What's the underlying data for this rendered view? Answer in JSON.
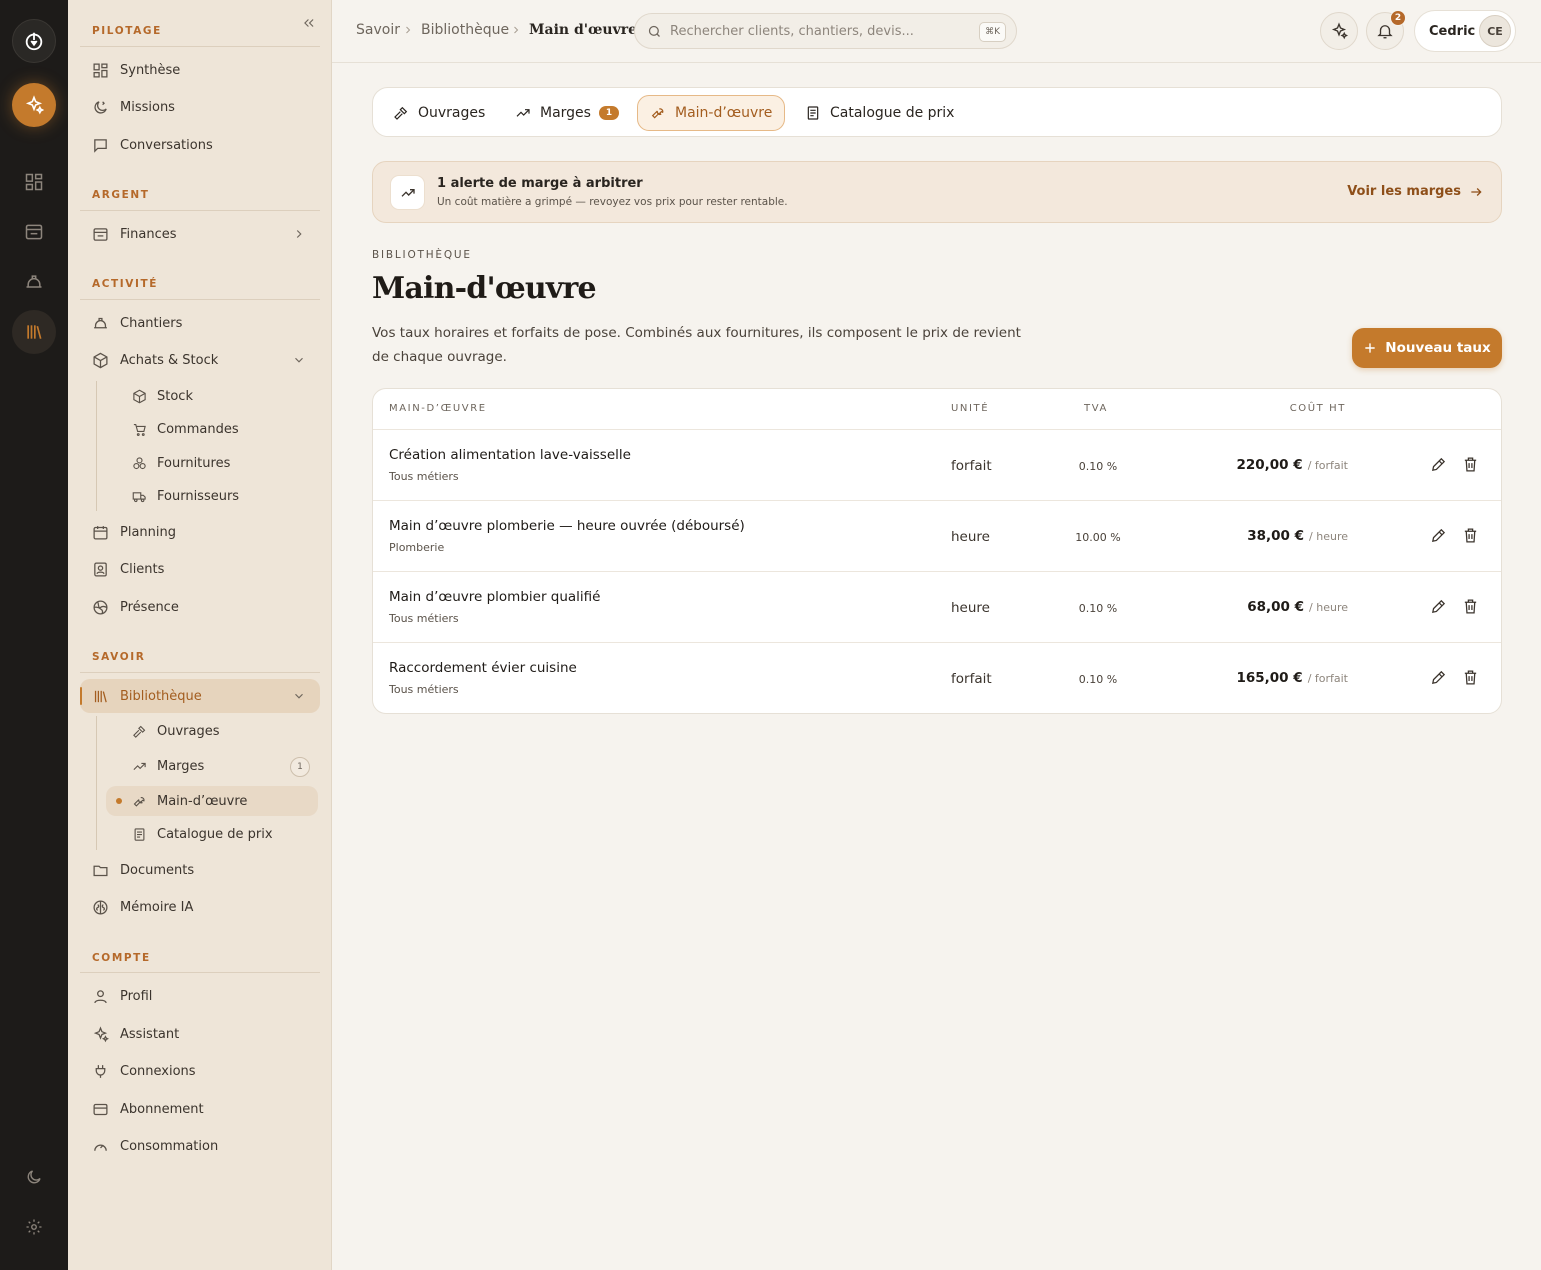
{
  "sidebar": {
    "sections": {
      "pilotage": "PILOTAGE",
      "argent": "ARGENT",
      "activite": "ACTIVITÉ",
      "savoir": "SAVOIR",
      "compte": "COMPTE"
    },
    "items": {
      "synthese": "Synthèse",
      "missions": "Missions",
      "conversations": "Conversations",
      "finances": "Finances",
      "chantiers": "Chantiers",
      "achats": "Achats & Stock",
      "stock": "Stock",
      "commandes": "Commandes",
      "fournitures": "Fournitures",
      "fournisseurs": "Fournisseurs",
      "planning": "Planning",
      "clients": "Clients",
      "presence": "Présence",
      "bibliotheque": "Bibliothèque",
      "ouvrages": "Ouvrages",
      "marges": "Marges",
      "marges_count": "1",
      "main_oeuvre": "Main-d’œuvre",
      "catalogue": "Catalogue de prix",
      "documents": "Documents",
      "memoire": "Mémoire IA",
      "profil": "Profil",
      "assistant": "Assistant",
      "connexions": "Connexions",
      "abonnement": "Abonnement",
      "consommation": "Consommation"
    }
  },
  "topbar": {
    "breadcrumb": [
      "Savoir",
      "Bibliothèque",
      "Main d'œuvre"
    ],
    "search_placeholder": "Rechercher clients, chantiers, devis...",
    "search_shortcut": "⌘K",
    "notifications_count": "2",
    "user_name": "Cedric",
    "user_initials": "CE"
  },
  "tabs": [
    {
      "label": "Ouvrages"
    },
    {
      "label": "Marges",
      "badge": "1"
    },
    {
      "label": "Main-d’œuvre"
    },
    {
      "label": "Catalogue de prix"
    }
  ],
  "alert": {
    "title": "1 alerte de marge à arbitrer",
    "subtitle": "Un coût matière a grimpé — revoyez vos prix pour rester rentable.",
    "link": "Voir les marges"
  },
  "header": {
    "eyebrow": "BIBLIOTHÈQUE",
    "title": "Main-d'œuvre",
    "description": "Vos taux horaires et forfaits de pose. Combinés aux fournitures, ils composent le prix de revient de chaque ouvrage.",
    "new_button": "Nouveau taux"
  },
  "table": {
    "columns": [
      "MAIN-D’ŒUVRE",
      "UNITÉ",
      "TVA",
      "COÛT HT"
    ],
    "rows": [
      {
        "name": "Création alimentation lave-vaisselle",
        "category": "Tous métiers",
        "unit": "forfait",
        "tva": "0.10 %",
        "cost": "220,00 €",
        "per": "/ forfait"
      },
      {
        "name": "Main d’œuvre plomberie — heure ouvrée (déboursé)",
        "category": "Plomberie",
        "unit": "heure",
        "tva": "10.00 %",
        "cost": "38,00 €",
        "per": "/ heure"
      },
      {
        "name": "Main d’œuvre plombier qualifié",
        "category": "Tous métiers",
        "unit": "heure",
        "tva": "0.10 %",
        "cost": "68,00 €",
        "per": "/ heure"
      },
      {
        "name": "Raccordement évier cuisine",
        "category": "Tous métiers",
        "unit": "forfait",
        "tva": "0.10 %",
        "cost": "165,00 €",
        "per": "/ forfait"
      }
    ]
  },
  "colors": {
    "accent": "#c47a2c",
    "rail": "#1d1b19",
    "sidebar": "#eee5d8"
  }
}
